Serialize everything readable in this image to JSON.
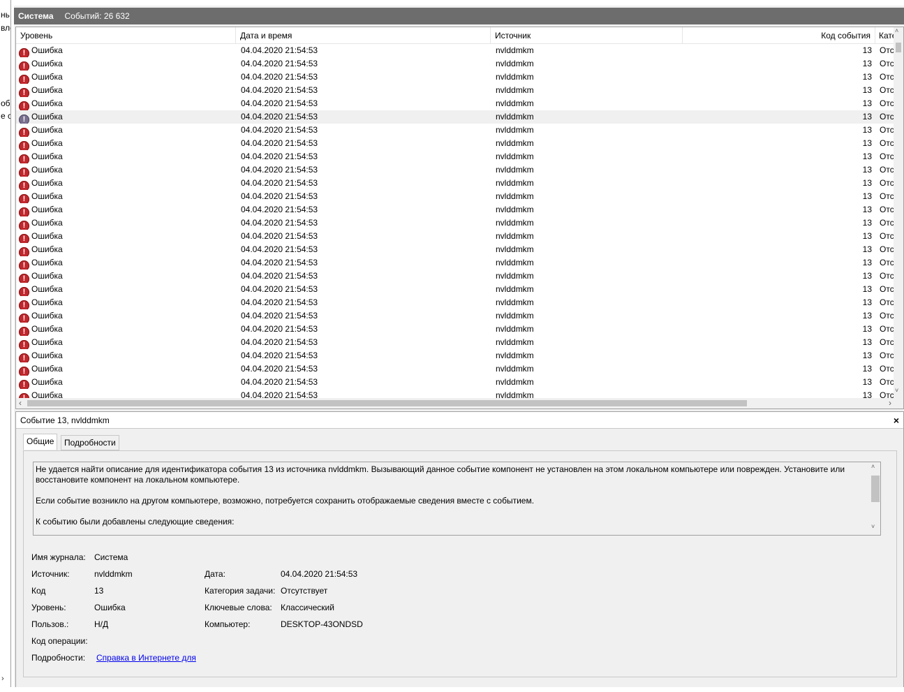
{
  "left_panel": {
    "fragments": [
      "нь",
      "вле",
      "об",
      "е сл"
    ],
    "arrow": "›"
  },
  "header": {
    "log_name": "Система",
    "event_count": "Событий: 26 632"
  },
  "list": {
    "columns": {
      "level": "Уровень",
      "date": "Дата и время",
      "source": "Источник",
      "code": "Код события",
      "category": "Категория"
    },
    "rows": [
      {
        "level": "Ошибка",
        "date": "04.04.2020 21:54:53",
        "source": "nvlddmkm",
        "code": "13",
        "category": "Отсутствует"
      },
      {
        "level": "Ошибка",
        "date": "04.04.2020 21:54:53",
        "source": "nvlddmkm",
        "code": "13",
        "category": "Отсутствует"
      },
      {
        "level": "Ошибка",
        "date": "04.04.2020 21:54:53",
        "source": "nvlddmkm",
        "code": "13",
        "category": "Отсутствует"
      },
      {
        "level": "Ошибка",
        "date": "04.04.2020 21:54:53",
        "source": "nvlddmkm",
        "code": "13",
        "category": "Отсутствует"
      },
      {
        "level": "Ошибка",
        "date": "04.04.2020 21:54:53",
        "source": "nvlddmkm",
        "code": "13",
        "category": "Отсутствует"
      },
      {
        "level": "Ошибка",
        "date": "04.04.2020 21:54:53",
        "source": "nvlddmkm",
        "code": "13",
        "category": "Отсутствует",
        "selected": true
      },
      {
        "level": "Ошибка",
        "date": "04.04.2020 21:54:53",
        "source": "nvlddmkm",
        "code": "13",
        "category": "Отсутствует"
      },
      {
        "level": "Ошибка",
        "date": "04.04.2020 21:54:53",
        "source": "nvlddmkm",
        "code": "13",
        "category": "Отсутствует"
      },
      {
        "level": "Ошибка",
        "date": "04.04.2020 21:54:53",
        "source": "nvlddmkm",
        "code": "13",
        "category": "Отсутствует"
      },
      {
        "level": "Ошибка",
        "date": "04.04.2020 21:54:53",
        "source": "nvlddmkm",
        "code": "13",
        "category": "Отсутствует"
      },
      {
        "level": "Ошибка",
        "date": "04.04.2020 21:54:53",
        "source": "nvlddmkm",
        "code": "13",
        "category": "Отсутствует"
      },
      {
        "level": "Ошибка",
        "date": "04.04.2020 21:54:53",
        "source": "nvlddmkm",
        "code": "13",
        "category": "Отсутствует"
      },
      {
        "level": "Ошибка",
        "date": "04.04.2020 21:54:53",
        "source": "nvlddmkm",
        "code": "13",
        "category": "Отсутствует"
      },
      {
        "level": "Ошибка",
        "date": "04.04.2020 21:54:53",
        "source": "nvlddmkm",
        "code": "13",
        "category": "Отсутствует"
      },
      {
        "level": "Ошибка",
        "date": "04.04.2020 21:54:53",
        "source": "nvlddmkm",
        "code": "13",
        "category": "Отсутствует"
      },
      {
        "level": "Ошибка",
        "date": "04.04.2020 21:54:53",
        "source": "nvlddmkm",
        "code": "13",
        "category": "Отсутствует"
      },
      {
        "level": "Ошибка",
        "date": "04.04.2020 21:54:53",
        "source": "nvlddmkm",
        "code": "13",
        "category": "Отсутствует"
      },
      {
        "level": "Ошибка",
        "date": "04.04.2020 21:54:53",
        "source": "nvlddmkm",
        "code": "13",
        "category": "Отсутствует"
      },
      {
        "level": "Ошибка",
        "date": "04.04.2020 21:54:53",
        "source": "nvlddmkm",
        "code": "13",
        "category": "Отсутствует"
      },
      {
        "level": "Ошибка",
        "date": "04.04.2020 21:54:53",
        "source": "nvlddmkm",
        "code": "13",
        "category": "Отсутствует"
      },
      {
        "level": "Ошибка",
        "date": "04.04.2020 21:54:53",
        "source": "nvlddmkm",
        "code": "13",
        "category": "Отсутствует"
      },
      {
        "level": "Ошибка",
        "date": "04.04.2020 21:54:53",
        "source": "nvlddmkm",
        "code": "13",
        "category": "Отсутствует"
      },
      {
        "level": "Ошибка",
        "date": "04.04.2020 21:54:53",
        "source": "nvlddmkm",
        "code": "13",
        "category": "Отсутствует"
      },
      {
        "level": "Ошибка",
        "date": "04.04.2020 21:54:53",
        "source": "nvlddmkm",
        "code": "13",
        "category": "Отсутствует"
      },
      {
        "level": "Ошибка",
        "date": "04.04.2020 21:54:53",
        "source": "nvlddmkm",
        "code": "13",
        "category": "Отсутствует"
      },
      {
        "level": "Ошибка",
        "date": "04.04.2020 21:54:53",
        "source": "nvlddmkm",
        "code": "13",
        "category": "Отсутствует"
      },
      {
        "level": "Ошибка",
        "date": "04.04.2020 21:54:53",
        "source": "nvlddmkm",
        "code": "13",
        "category": "Отсутствует"
      }
    ],
    "scroll": {
      "up": "˄",
      "down": "˅",
      "left": "‹",
      "right": "›"
    }
  },
  "detail": {
    "title": "Событие 13, nvlddmkm",
    "close": "×",
    "tabs": [
      "Общие",
      "Подробности"
    ],
    "description": [
      "Не удается найти описание для идентификатора события 13 из источника nvlddmkm. Вызывающий данное событие компонент не установлен на этом локальном компьютере или поврежден. Установите или восстановите компонент на локальном компьютере.",
      "Если событие возникло на другом компьютере, возможно, потребуется сохранить отображаемые сведения вместе с событием.",
      "К событию были добавлены следующие сведения:"
    ],
    "fields": {
      "log_label": "Имя журнала:",
      "log_value": "Система",
      "source_label": "Источник:",
      "source_value": "nvlddmkm",
      "date_label": "Дата:",
      "date_value": "04.04.2020 21:54:53",
      "code_label": "Код",
      "code_value": "13",
      "task_label": "Категория задачи:",
      "task_value": "Отсутствует",
      "level_label": "Уровень:",
      "level_value": "Ошибка",
      "keywords_label": "Ключевые слова:",
      "keywords_value": "Классический",
      "user_label": "Пользов.:",
      "user_value": "Н/Д",
      "computer_label": "Компьютер:",
      "computer_value": "DESKTOP-43ONDSD",
      "opcode_label": "Код операции:",
      "opcode_value": "",
      "more_label": "Подробности:",
      "more_link": "Справка в Интернете для "
    }
  }
}
